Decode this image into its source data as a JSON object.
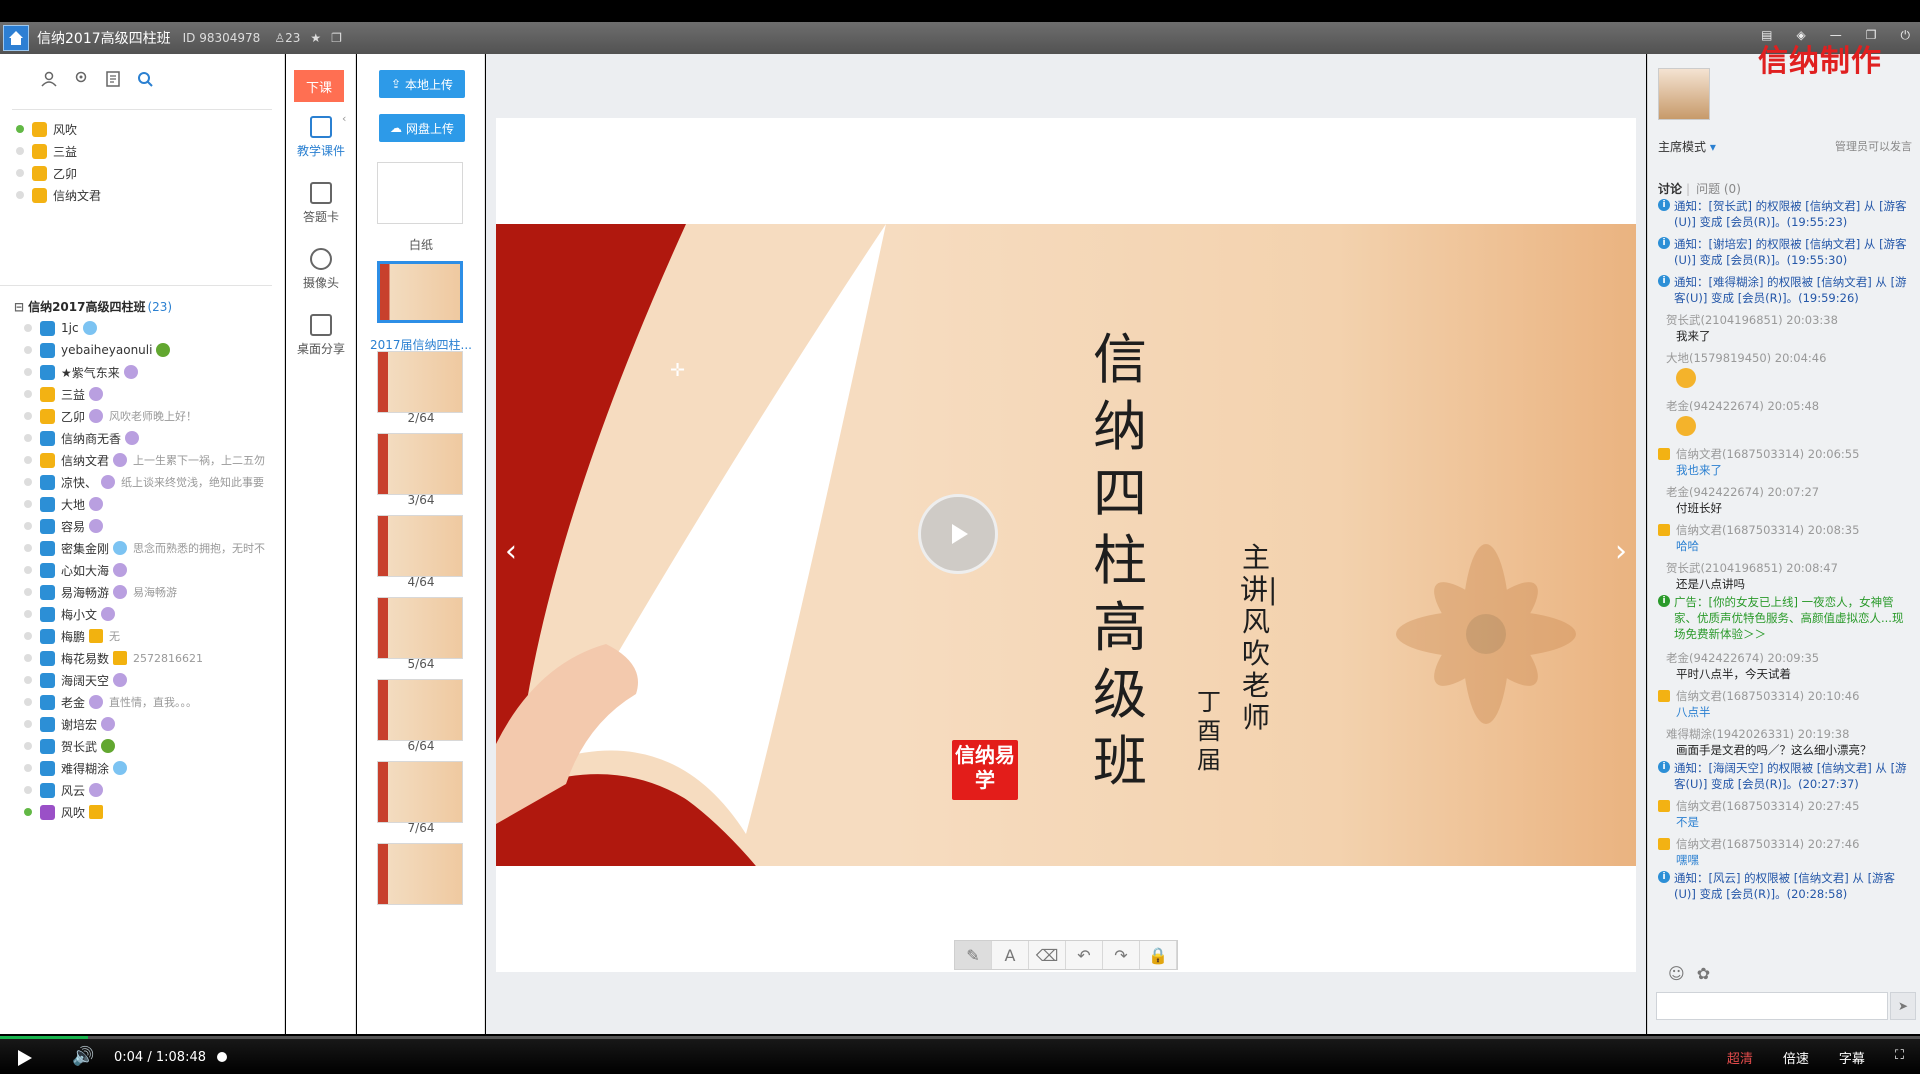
{
  "topbar": {
    "title": "信纳2017高级四柱班",
    "room_id": "ID 98304978",
    "user_count": "23"
  },
  "watermark": "信纳制作",
  "admins": [
    {
      "name": "风吹",
      "online": true
    },
    {
      "name": "三益",
      "online": false
    },
    {
      "name": "乙卯",
      "online": false
    },
    {
      "name": "信纳文君",
      "online": false
    }
  ],
  "group": {
    "name": "信纳2017高级四柱班",
    "count": "(23)"
  },
  "users": [
    {
      "name": "1jc",
      "role": "blue",
      "badge": "b-blue",
      "note": "",
      "online": false
    },
    {
      "name": "yebaiheyaonuli",
      "role": "blue",
      "badge": "b-green",
      "note": "",
      "online": false
    },
    {
      "name": "★紫气东来",
      "role": "blue",
      "badge": "b-purple",
      "note": "",
      "online": false
    },
    {
      "name": "三益",
      "role": "gold",
      "badge": "b-purple",
      "note": "",
      "online": false
    },
    {
      "name": "乙卯",
      "role": "gold",
      "badge": "b-purple",
      "note": "风吹老师晚上好！",
      "online": false
    },
    {
      "name": "信纳商无香",
      "role": "blue",
      "badge": "b-purple",
      "note": "",
      "online": false
    },
    {
      "name": "信纳文君",
      "role": "gold",
      "badge": "b-purple",
      "note": "上一生累下一祸，上二五勿",
      "online": false
    },
    {
      "name": "凉快、",
      "role": "blue",
      "badge": "b-purple",
      "note": "纸上谈来终觉浅，绝知此事要",
      "online": false
    },
    {
      "name": "大地",
      "role": "blue",
      "badge": "b-purple",
      "note": "",
      "online": false
    },
    {
      "name": "容易",
      "role": "blue",
      "badge": "b-purple",
      "note": "",
      "online": false
    },
    {
      "name": "密集金刚",
      "role": "blue",
      "badge": "b-blue",
      "note": "思念而熟悉的拥抱，无时不",
      "online": false
    },
    {
      "name": "心如大海",
      "role": "blue",
      "badge": "b-purple",
      "note": "",
      "online": false
    },
    {
      "name": "易海畅游",
      "role": "blue",
      "badge": "b-purple",
      "note": "易海畅游",
      "online": false
    },
    {
      "name": "梅小文",
      "role": "blue",
      "badge": "b-purple",
      "note": "",
      "online": false
    },
    {
      "name": "梅鹏",
      "role": "blue",
      "badge": "b-crown",
      "note": "无",
      "online": false
    },
    {
      "name": "梅花易数",
      "role": "blue",
      "badge": "b-crown",
      "note": "2572816621",
      "online": false
    },
    {
      "name": "海阔天空",
      "role": "blue",
      "badge": "b-purple",
      "note": "",
      "online": false
    },
    {
      "name": "老金",
      "role": "blue",
      "badge": "b-purple",
      "note": "直性情，直我。。。",
      "online": false
    },
    {
      "name": "谢培宏",
      "role": "blue",
      "badge": "b-purple",
      "note": "",
      "online": false
    },
    {
      "name": "贺长武",
      "role": "blue",
      "badge": "b-green",
      "note": "",
      "online": false
    },
    {
      "name": "难得糊涂",
      "role": "blue",
      "badge": "b-blue",
      "note": "",
      "online": false
    },
    {
      "name": "风云",
      "role": "blue",
      "badge": "b-purple",
      "note": "",
      "online": false
    },
    {
      "name": "风吹",
      "role": "purple",
      "badge": "b-crown",
      "note": "",
      "online": true
    }
  ],
  "nav": {
    "end_class": "下课",
    "courseware": "教学课件",
    "answer_card": "答题卡",
    "camera": "摄像头",
    "desktop_share": "桌面分享"
  },
  "thumbs": {
    "local_upload": "本地上传",
    "cloud_upload": "网盘上传",
    "blank": "白纸",
    "selected": "2017届信纳四柱...",
    "pages": [
      "2/64",
      "3/64",
      "4/64",
      "5/64",
      "6/64",
      "7/64"
    ]
  },
  "slide": {
    "title": "信纳四柱高级班",
    "lecturer": "主讲|风吹老师",
    "term": "丁酉届",
    "seal": "信纳易学"
  },
  "right": {
    "mode": "主席模式",
    "admin_note": "管理员可以发言",
    "tab_discuss": "讨论",
    "tab_question": "问题 (0)"
  },
  "chat": [
    {
      "t": "notice",
      "text": "通知：[贺长武] 的权限被 [信纳文君] 从 [游客(U)] 变成 [会员(R)]。(19:55:23)"
    },
    {
      "t": "notice",
      "text": "通知：[谢培宏] 的权限被 [信纳文君] 从 [游客(U)] 变成 [会员(R)]。(19:55:30)"
    },
    {
      "t": "notice",
      "text": "通知：[难得糊涂] 的权限被 [信纳文君] 从 [游客(U)] 变成 [会员(R)]。(19:59:26)"
    },
    {
      "t": "who",
      "text": "贺长武(2104196851) 20:03:38"
    },
    {
      "t": "msg",
      "text": "我来了"
    },
    {
      "t": "who",
      "text": "大地(1579819450) 20:04:46"
    },
    {
      "t": "emo",
      "text": ""
    },
    {
      "t": "who",
      "text": "老金(942422674) 20:05:48"
    },
    {
      "t": "emo",
      "text": ""
    },
    {
      "t": "whog",
      "text": "信纳文君(1687503314) 20:06:55"
    },
    {
      "t": "msgb",
      "text": "我也来了"
    },
    {
      "t": "who",
      "text": "老金(942422674) 20:07:27"
    },
    {
      "t": "msg",
      "text": "付班长好"
    },
    {
      "t": "whog",
      "text": "信纳文君(1687503314) 20:08:35"
    },
    {
      "t": "msgb",
      "text": "哈哈"
    },
    {
      "t": "who",
      "text": "贺长武(2104196851) 20:08:47"
    },
    {
      "t": "msg",
      "text": "还是八点讲吗"
    },
    {
      "t": "ad",
      "text": "广告：[你的女友已上线] 一夜恋人，女神管家、优质声优特色服务、高颜值虚拟恋人...现场免费新体验＞＞"
    },
    {
      "t": "who",
      "text": "老金(942422674) 20:09:35"
    },
    {
      "t": "msg",
      "text": "平时八点半，今天试着"
    },
    {
      "t": "whog",
      "text": "信纳文君(1687503314) 20:10:46"
    },
    {
      "t": "msgb",
      "text": "八点半"
    },
    {
      "t": "who",
      "text": "难得糊涂(1942026331) 20:19:38"
    },
    {
      "t": "msg",
      "text": "画面手是文君的吗／？这么细小漂亮？"
    },
    {
      "t": "notice",
      "text": "通知：[海阔天空] 的权限被 [信纳文君] 从 [游客(U)] 变成 [会员(R)]。(20:27:37)"
    },
    {
      "t": "whog",
      "text": "信纳文君(1687503314) 20:27:45"
    },
    {
      "t": "msgb",
      "text": "不是"
    },
    {
      "t": "whog",
      "text": "信纳文君(1687503314) 20:27:46"
    },
    {
      "t": "msgb",
      "text": "嘿嘿"
    },
    {
      "t": "notice",
      "text": "通知：[风云] 的权限被 [信纳文君] 从 [游客(U)] 变成 [会员(R)]。(20:28:58)"
    }
  ],
  "video": {
    "current": "0:04",
    "separator": "/",
    "total": "1:08:48",
    "progress_fraction": 0.0009,
    "hd": "超清",
    "speed": "倍速",
    "subtitle": "字幕"
  },
  "colors": {
    "accent": "#2d8ee6",
    "end_class": "#ff6f52",
    "watermark": "#e02020"
  }
}
